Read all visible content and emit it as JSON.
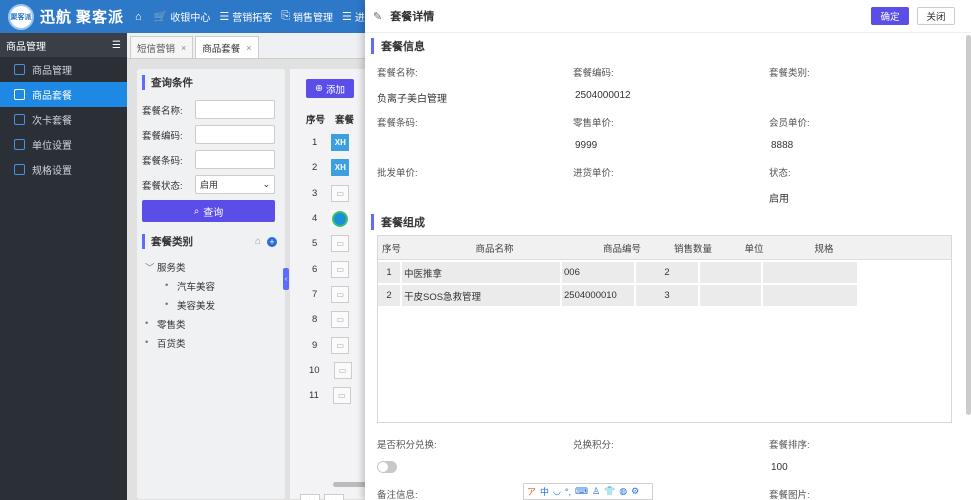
{
  "brand": {
    "logo_text": "聚客派",
    "name1": "迅航",
    "name2": "聚客派"
  },
  "topnav": [
    {
      "icon": "⌂",
      "label": ""
    },
    {
      "icon": "🛒",
      "label": "收银中心"
    },
    {
      "icon": "☰",
      "label": "营销拓客"
    },
    {
      "icon": "⎘",
      "label": "销售管理"
    },
    {
      "icon": "☰",
      "label": "进"
    }
  ],
  "sidebar": {
    "header": "商品管理",
    "items": [
      {
        "label": "商品管理"
      },
      {
        "label": "商品套餐"
      },
      {
        "label": "次卡套餐"
      },
      {
        "label": "单位设置"
      },
      {
        "label": "规格设置"
      }
    ]
  },
  "tabs": [
    {
      "label": "短信营销",
      "close": "×"
    },
    {
      "label": "商品套餐",
      "close": "×"
    }
  ],
  "query": {
    "title": "查询条件",
    "fields": [
      {
        "label": "套餐名称:",
        "value": ""
      },
      {
        "label": "套餐编码:",
        "value": ""
      },
      {
        "label": "套餐条码:",
        "value": ""
      },
      {
        "label": "套餐状态:",
        "value": "启用"
      }
    ],
    "button": "查询"
  },
  "category": {
    "title": "套餐类别",
    "tree": [
      {
        "mark": "﹀",
        "label": "服务类",
        "level": 1
      },
      {
        "mark": "•",
        "label": "汽车美容",
        "level": 2
      },
      {
        "mark": "•",
        "label": "美容美发",
        "level": 2
      },
      {
        "mark": "•",
        "label": "零售类",
        "level": 1
      },
      {
        "mark": "•",
        "label": "百货类",
        "level": 1
      }
    ]
  },
  "grid": {
    "add_label": "添加",
    "headers": [
      "序号",
      "套餐"
    ],
    "rows": [
      "1",
      "2",
      "3",
      "4",
      "5",
      "6",
      "7",
      "8",
      "9",
      "10",
      "11"
    ]
  },
  "pager": [
    "<<",
    "<"
  ],
  "drawer": {
    "title": "套餐详情",
    "ok": "确定",
    "close": "关闭",
    "info_title": "套餐信息",
    "fields": [
      {
        "label": "套餐名称:",
        "value": "负离子美白管理"
      },
      {
        "label": "套餐编码:",
        "value": "2504000012"
      },
      {
        "label": "套餐类别:",
        "value": ""
      },
      {
        "label": "套餐条码:",
        "value": ""
      },
      {
        "label": "零售单价:",
        "value": "9999"
      },
      {
        "label": "会员单价:",
        "value": "8888"
      },
      {
        "label": "批发单价:",
        "value": ""
      },
      {
        "label": "进货单价:",
        "value": ""
      },
      {
        "label": "状态:",
        "value": "启用"
      }
    ],
    "comp_title": "套餐组成",
    "comp_headers": [
      "序号",
      "商品名称",
      "商品编号",
      "销售数量",
      "单位",
      "规格"
    ],
    "comp_rows": [
      {
        "no": "1",
        "name": "中医推拿",
        "code": "006",
        "qty": "2",
        "unit": "",
        "spec": ""
      },
      {
        "no": "2",
        "name": "干皮SOS急救管理",
        "code": "2504000010",
        "qty": "3",
        "unit": "",
        "spec": ""
      }
    ],
    "points_label": "是否积分兑换:",
    "points_value_label": "兑换积分:",
    "sort_label": "套餐排序:",
    "sort_value": "100",
    "remark_label": "备注信息:",
    "image_label": "套餐图片:"
  },
  "ime": [
    "ア",
    "中",
    "◡",
    "°,",
    "⌨",
    "♙",
    "👕",
    "◍",
    "⚙"
  ]
}
